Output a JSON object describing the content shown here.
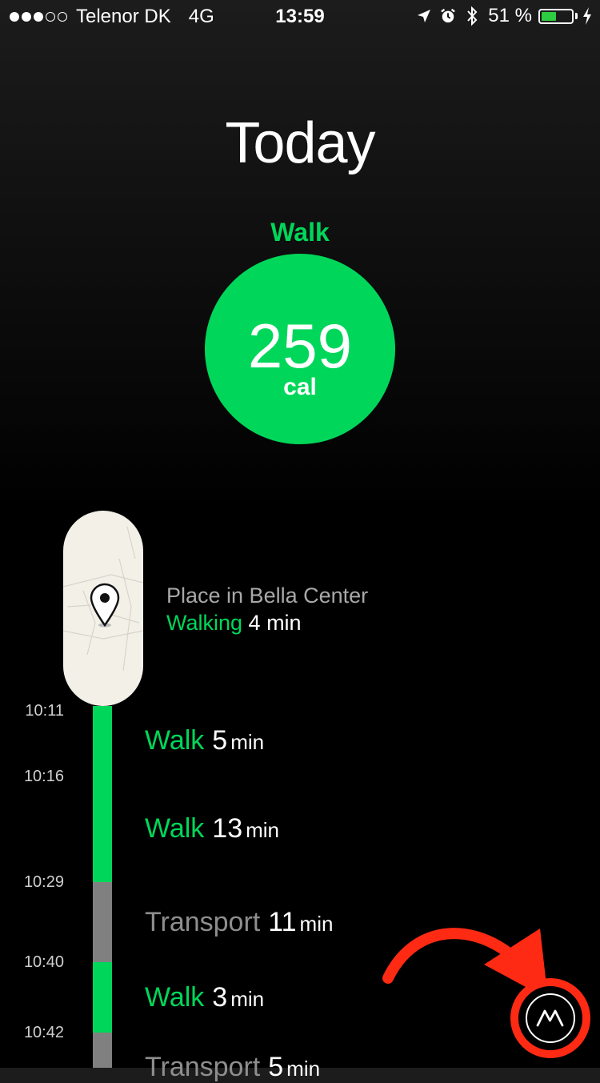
{
  "status_bar": {
    "carrier": "Telenor DK",
    "network": "4G",
    "time": "13:59",
    "battery_percent": "51 %",
    "battery_level": 0.51,
    "signal_bars_filled": 3,
    "signal_bars_total": 5,
    "icons": [
      "location-arrow-icon",
      "alarm-icon",
      "bluetooth-icon",
      "charging-bolt-icon"
    ]
  },
  "header": {
    "title": "Today"
  },
  "summary": {
    "activity": "Walk",
    "value": "259",
    "unit": "cal",
    "color": "#00d75a"
  },
  "place": {
    "name": "Place in Bella Center",
    "activity": "Walking",
    "duration": "4 min"
  },
  "timeline": {
    "times": [
      "10:11",
      "10:16",
      "10:29",
      "10:40",
      "10:42"
    ],
    "rows": [
      {
        "activity": "Walk",
        "value": "5",
        "unit": "min"
      },
      {
        "activity": "Walk",
        "value": "13",
        "unit": "min"
      },
      {
        "activity": "Transport",
        "value": "11",
        "unit": "min"
      },
      {
        "activity": "Walk",
        "value": "3",
        "unit": "min"
      },
      {
        "activity": "Transport",
        "value": "5",
        "unit": "min"
      }
    ]
  },
  "colors": {
    "walk": "#00d75a",
    "transport": "#808080",
    "highlight": "#ff2a14"
  }
}
